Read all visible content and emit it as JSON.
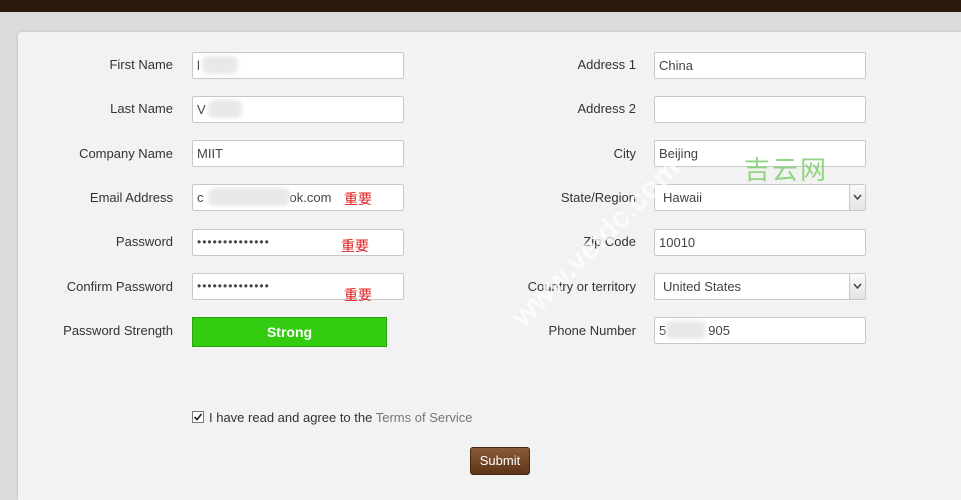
{
  "form": {
    "left": {
      "first_name": {
        "label": "First Name",
        "value": "l"
      },
      "last_name": {
        "label": "Last Name",
        "value": "V"
      },
      "company_name": {
        "label": "Company Name",
        "value": "MIIT"
      },
      "email": {
        "label": "Email Address",
        "value": "c",
        "value_suffix": "ok.com",
        "note": "重要"
      },
      "password": {
        "label": "Password",
        "value": "••••••••••••••",
        "note": "重要"
      },
      "confirm_password": {
        "label": "Confirm Password",
        "value": "••••••••••••••",
        "note": "重要"
      },
      "password_strength": {
        "label": "Password Strength",
        "value": "Strong"
      }
    },
    "right": {
      "address1": {
        "label": "Address 1",
        "value": "China"
      },
      "address2": {
        "label": "Address 2",
        "value": ""
      },
      "city": {
        "label": "City",
        "value": "Beijing"
      },
      "state": {
        "label": "State/Region",
        "value": "Hawaii"
      },
      "zip": {
        "label": "Zip Code",
        "value": "10010"
      },
      "country": {
        "label": "Country or territory",
        "value": "United States"
      },
      "phone": {
        "label": "Phone Number",
        "value": "5",
        "value_suffix": "905"
      }
    },
    "agree": {
      "text": "I have read and agree to the ",
      "link": "Terms of Service",
      "checked": true
    },
    "submit_label": "Submit"
  },
  "watermark": {
    "brand": "吉云网",
    "url": "www.veidc.com"
  },
  "colors": {
    "strength": "#33cc11",
    "submit": "#6e4224",
    "note": "#e02020",
    "topbar": "#2a1a0e"
  }
}
